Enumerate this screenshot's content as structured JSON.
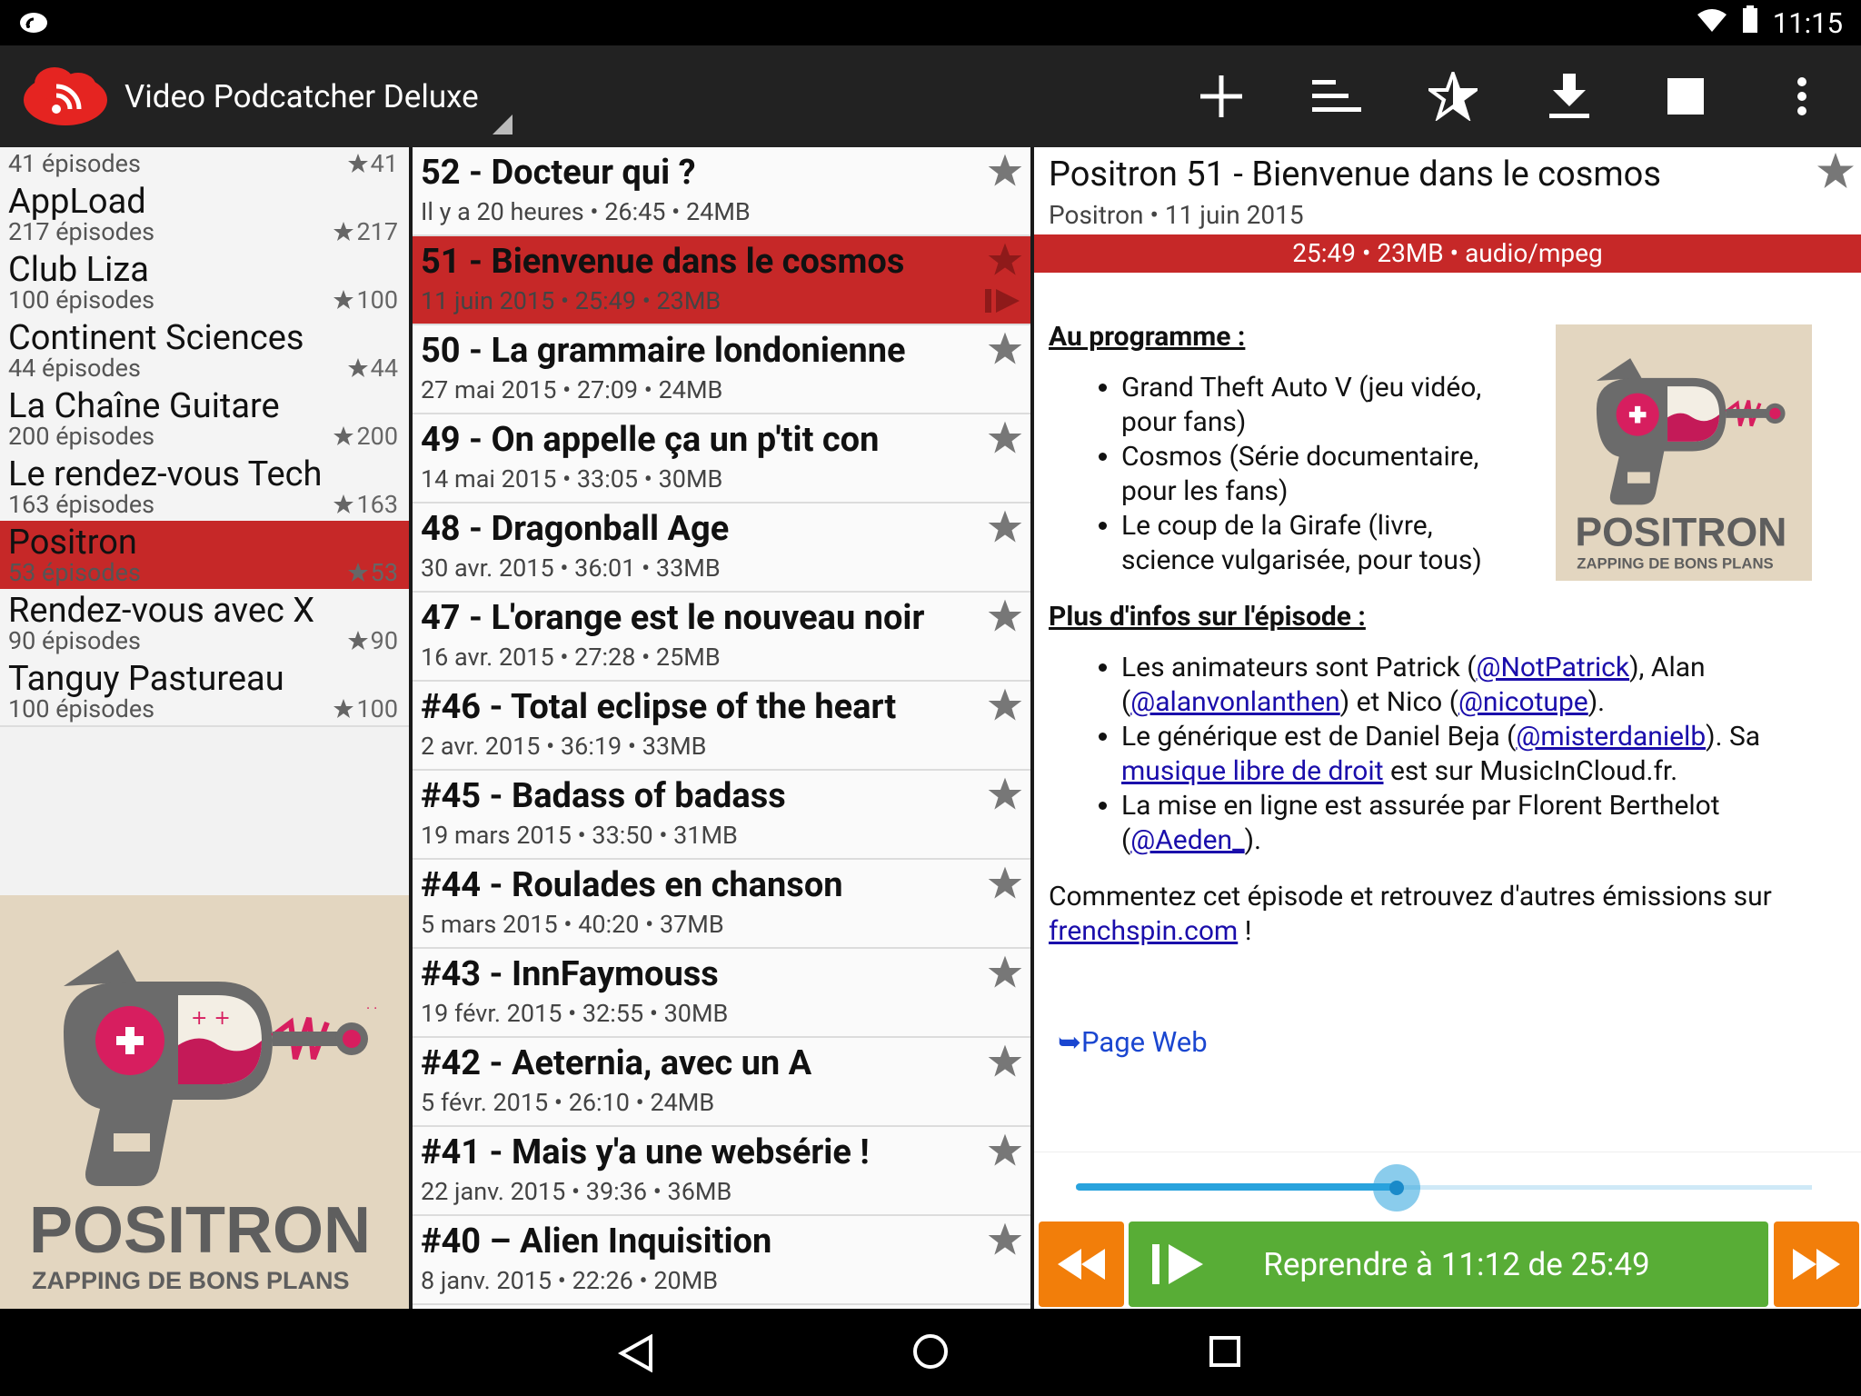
{
  "status_bar": {
    "time": "11:15"
  },
  "app": {
    "title": "Video Podcatcher Deluxe"
  },
  "toolbar": {
    "icons": [
      "add-icon",
      "sort-icon",
      "favorite-star-icon",
      "download-icon",
      "stop-icon",
      "overflow-menu-icon"
    ]
  },
  "podcasts": [
    {
      "name": "",
      "count": "41 épisodes",
      "stars": "41"
    },
    {
      "name": "AppLoad",
      "count": "217 épisodes",
      "stars": "217"
    },
    {
      "name": "Club Liza",
      "count": "100 épisodes",
      "stars": "100"
    },
    {
      "name": "Continent Sciences",
      "count": "44 épisodes",
      "stars": "44"
    },
    {
      "name": "La Chaîne Guitare",
      "count": "200 épisodes",
      "stars": "200"
    },
    {
      "name": "Le rendez-vous Tech",
      "count": "163 épisodes",
      "stars": "163"
    },
    {
      "name": "Positron",
      "count": "53 épisodes",
      "stars": "53"
    },
    {
      "name": "Rendez-vous avec X",
      "count": "90 épisodes",
      "stars": "90"
    },
    {
      "name": "Tanguy Pastureau",
      "count": "100 épisodes",
      "stars": "100"
    }
  ],
  "artwork": {
    "brand": "POSITRON",
    "tagline": "ZAPPING DE BONS PLANS"
  },
  "episodes": [
    {
      "title": "52 - Docteur qui ?",
      "meta": "Il y a 20 heures • 26:45 • 24MB"
    },
    {
      "title": "51 - Bienvenue dans le cosmos",
      "meta": "11 juin 2015 • 25:49 • 23MB"
    },
    {
      "title": "50 - La grammaire londonienne",
      "meta": "27 mai 2015 • 27:09 • 24MB"
    },
    {
      "title": "49 - On appelle ça un p'tit con",
      "meta": "14 mai 2015 • 33:05 • 30MB"
    },
    {
      "title": "48 - Dragonball Age",
      "meta": "30 avr. 2015 • 36:01 • 33MB"
    },
    {
      "title": "47 - L'orange est le nouveau noir",
      "meta": "16 avr. 2015 • 27:28 • 25MB"
    },
    {
      "title": "#46 - Total eclipse of the heart",
      "meta": "2 avr. 2015 • 36:19 • 33MB"
    },
    {
      "title": "#45 - Badass of badass",
      "meta": "19 mars 2015 • 33:50 • 31MB"
    },
    {
      "title": "#44 - Roulades en chanson",
      "meta": "5 mars 2015 • 40:20 • 37MB"
    },
    {
      "title": "#43 - InnFaymouss",
      "meta": "19 févr. 2015 • 32:55 • 30MB"
    },
    {
      "title": "#42 - Aeternia, avec un A",
      "meta": "5 févr. 2015 • 26:10 • 24MB"
    },
    {
      "title": "#41 - Mais y'a une websérie !",
      "meta": "22 janv. 2015 • 39:36 • 36MB"
    },
    {
      "title": "#40 – Alien Inquisition",
      "meta": "8 janv. 2015 • 22:26 • 20MB"
    }
  ],
  "detail": {
    "title": "Positron 51 - Bienvenue dans le cosmos",
    "subtitle": "Positron • 11 juin 2015",
    "info_bar": "25:49 • 23MB • audio/mpeg",
    "section1_heading": "Au programme :",
    "program": [
      "Grand Theft Auto V (jeu vidéo, pour fans)",
      "Cosmos (Série documentaire, pour les fans)",
      "Le coup de la Girafe (livre, science vulgarisée, pour tous)"
    ],
    "section2_heading": "Plus d'infos sur l'épisode :",
    "info1": {
      "a": "Les animateurs sont Patrick (",
      "l1": "@NotPatrick",
      "b": "), Alan (",
      "l2": "@alanvonlanthen",
      "c": ") et Nico (",
      "l3": "@nicotupe",
      "d": ")."
    },
    "info2": {
      "a": "Le générique est de Daniel Beja (",
      "l1": "@misterdanielb",
      "b": "). Sa ",
      "l2": "musique libre de droit",
      "c": " est sur MusicInCloud.fr."
    },
    "info3": {
      "a": "La mise en ligne est assurée par Florent Berthelot (",
      "l1": "@Aeden_",
      "b": ")."
    },
    "comment_text": "Commentez cet épisode et retrouvez d'autres émissions sur ",
    "comment_link": "frenchspin.com",
    "comment_end": " !",
    "page_web": "➥Page Web",
    "progress": 0.436,
    "play_label": "Reprendre à 11:12 de 25:49"
  },
  "colors": {
    "accent_red": "#c62828",
    "play_green": "#58ad36",
    "seek_orange": "#f27e0a",
    "seek_blue": "#29a3dd"
  }
}
